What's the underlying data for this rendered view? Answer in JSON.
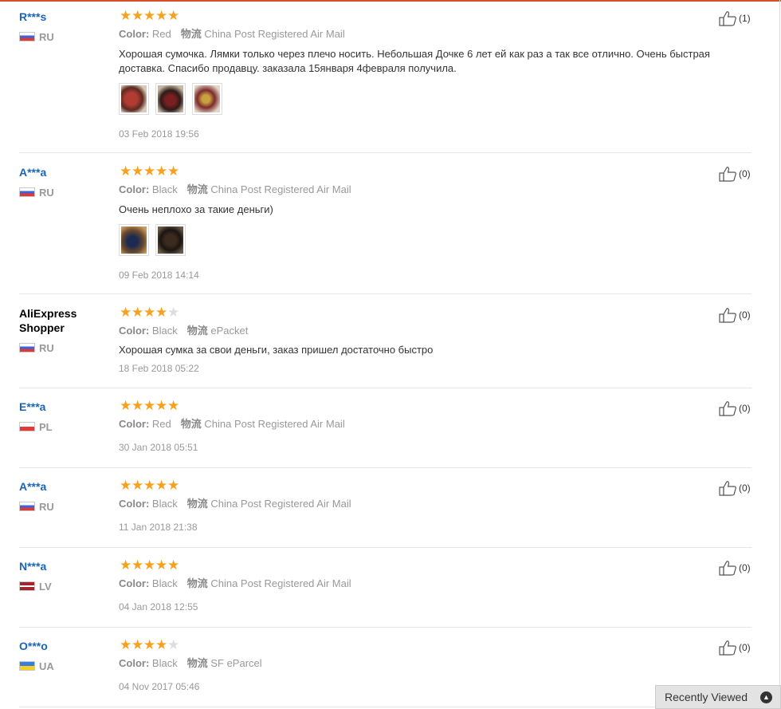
{
  "reviews": [
    {
      "user": "R***s",
      "country": "RU",
      "rating": 5,
      "color_label": "Color:",
      "color": "Red",
      "ship_label": "物流",
      "ship": "China Post Registered Air Mail",
      "text": "Хорошая сумочка. Лямки только через плечо носить. Небольшая Дочке 6 лет ей как раз а так все отлично. Очень быстрая доставка. Спасибо продавцу. заказала 15января 4февраля получила.",
      "date": "03 Feb 2018 19:56",
      "likes": "(1)"
    },
    {
      "user": "A***a",
      "country": "RU",
      "rating": 5,
      "color_label": "Color:",
      "color": "Black",
      "ship_label": "物流",
      "ship": "China Post Registered Air Mail",
      "text": "Очень неплохо за такие деньги)",
      "date": "09 Feb 2018 14:14",
      "likes": "(0)"
    },
    {
      "user": "AliExpress Shopper",
      "country": "RU",
      "rating": 4,
      "color_label": "Color:",
      "color": "Black",
      "ship_label": "物流",
      "ship": "ePacket",
      "text": "Хорошая сумка за свои деньги, заказ пришел достаточно быстро",
      "date": "18 Feb 2018 05:22",
      "likes": "(0)"
    },
    {
      "user": "E***a",
      "country": "PL",
      "rating": 5,
      "color_label": "Color:",
      "color": "Red",
      "ship_label": "物流",
      "ship": "China Post Registered Air Mail",
      "date": "30 Jan 2018 05:51",
      "likes": "(0)"
    },
    {
      "user": "A***a",
      "country": "RU",
      "rating": 5,
      "color_label": "Color:",
      "color": "Black",
      "ship_label": "物流",
      "ship": "China Post Registered Air Mail",
      "date": "11 Jan 2018 21:38",
      "likes": "(0)"
    },
    {
      "user": "N***a",
      "country": "LV",
      "rating": 5,
      "color_label": "Color:",
      "color": "Black",
      "ship_label": "物流",
      "ship": "China Post Registered Air Mail",
      "date": "04 Jan 2018 12:55",
      "likes": "(0)"
    },
    {
      "user": "O***o",
      "country": "UA",
      "rating": 4,
      "color_label": "Color:",
      "color": "Black",
      "ship_label": "物流",
      "ship": "SF eParcel",
      "date": "04 Nov 2017 05:46",
      "likes": "(0)"
    }
  ],
  "recently_viewed": {
    "label": "Recently Viewed"
  },
  "colors": {
    "star": "#f6a21f",
    "username": "#1a65b8",
    "accent_line": "#d4502b"
  }
}
